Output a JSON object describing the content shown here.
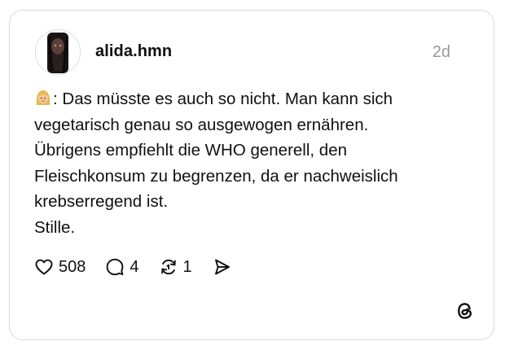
{
  "post": {
    "username": "alida.hmn",
    "time_ago": "2d",
    "lines": [
      ": Das müsste es auch so nicht. Man kann sich",
      "vegetarisch genau so ausgewogen ernähren.",
      "Übrigens empfiehlt die WHO generell, den",
      "Fleischkonsum zu begrenzen, da er nachweislich",
      "krebserregend ist.",
      "Stille."
    ],
    "emoji": "woman-emoji"
  },
  "actions": {
    "likes": "508",
    "replies": "4",
    "reposts": "1"
  },
  "icons": {
    "like": "heart-icon",
    "reply": "comment-icon",
    "repost": "repost-icon",
    "share": "send-icon",
    "brand": "threads-logo-icon"
  },
  "colors": {
    "text": "#101010",
    "muted": "#999999",
    "border": "#d9d9d9"
  }
}
